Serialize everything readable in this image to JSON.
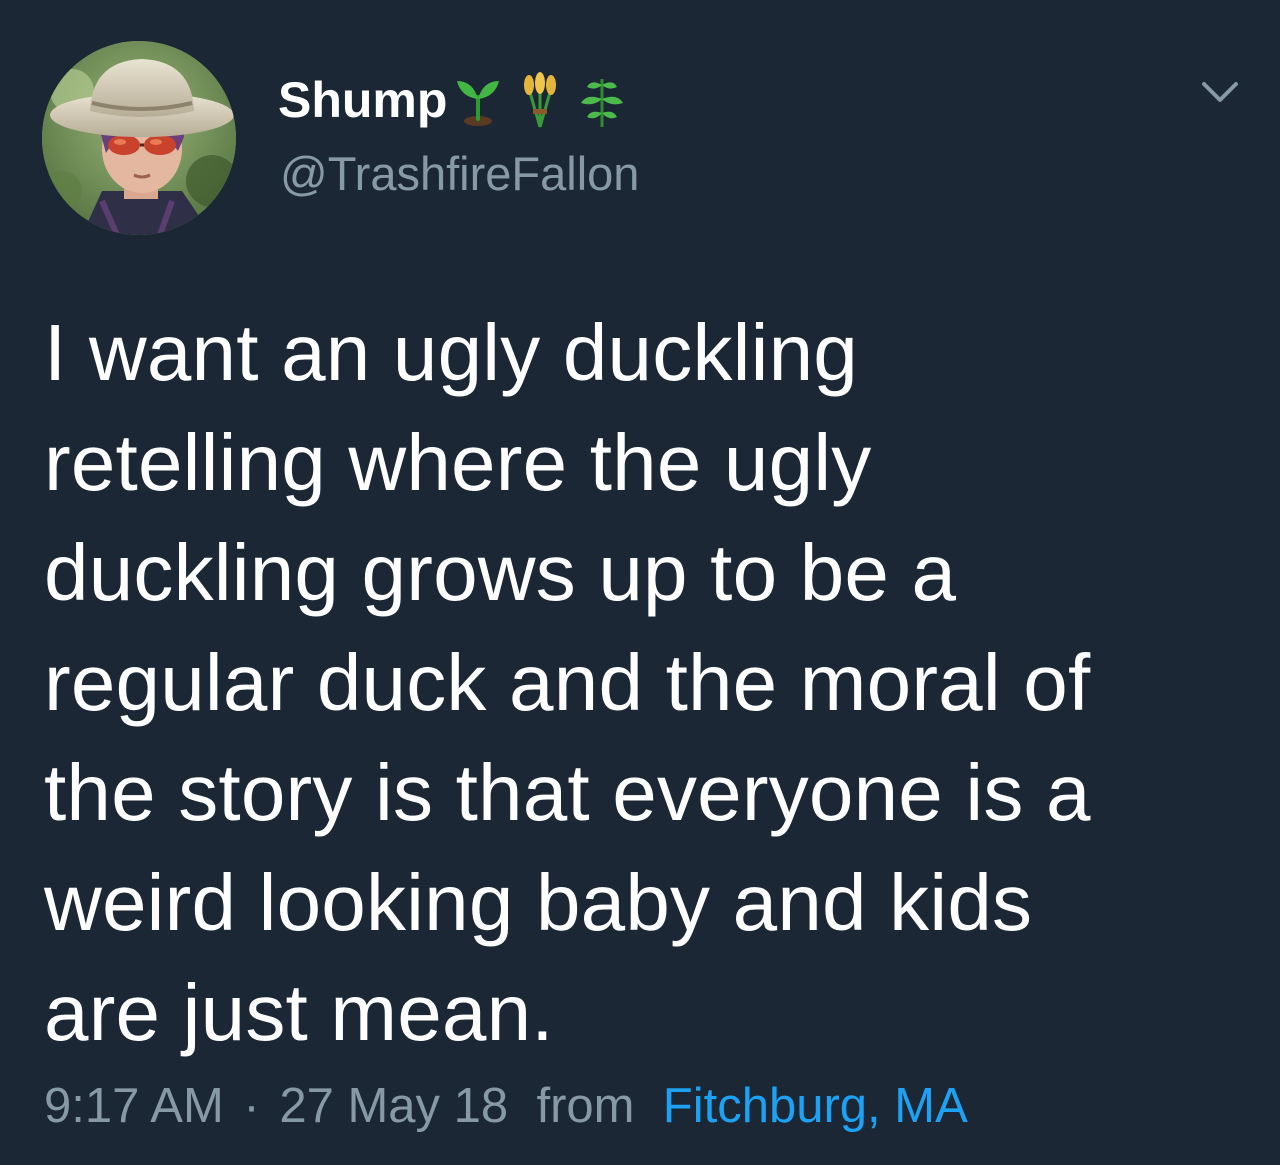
{
  "user": {
    "display_name": "Shump",
    "handle": "@TrashfireFallon",
    "name_emoji_icons": [
      "seedling-icon",
      "sheaf-of-rice-icon",
      "herb-icon"
    ]
  },
  "tweet": {
    "text_lines": [
      "I want an ugly duckling",
      "retelling where the ugly",
      "duckling grows up to be a",
      "regular duck and the moral of",
      "the story is that everyone is a",
      "weird looking baby and kids",
      "are just mean."
    ],
    "time": "9:17 AM",
    "separator": "·",
    "date": "27 May 18",
    "from_label": "from",
    "location": "Fitchburg, MA"
  },
  "colors": {
    "background": "#1c2735",
    "primary_text": "#ffffff",
    "secondary_text": "#8899a6",
    "link": "#1da1f2"
  }
}
